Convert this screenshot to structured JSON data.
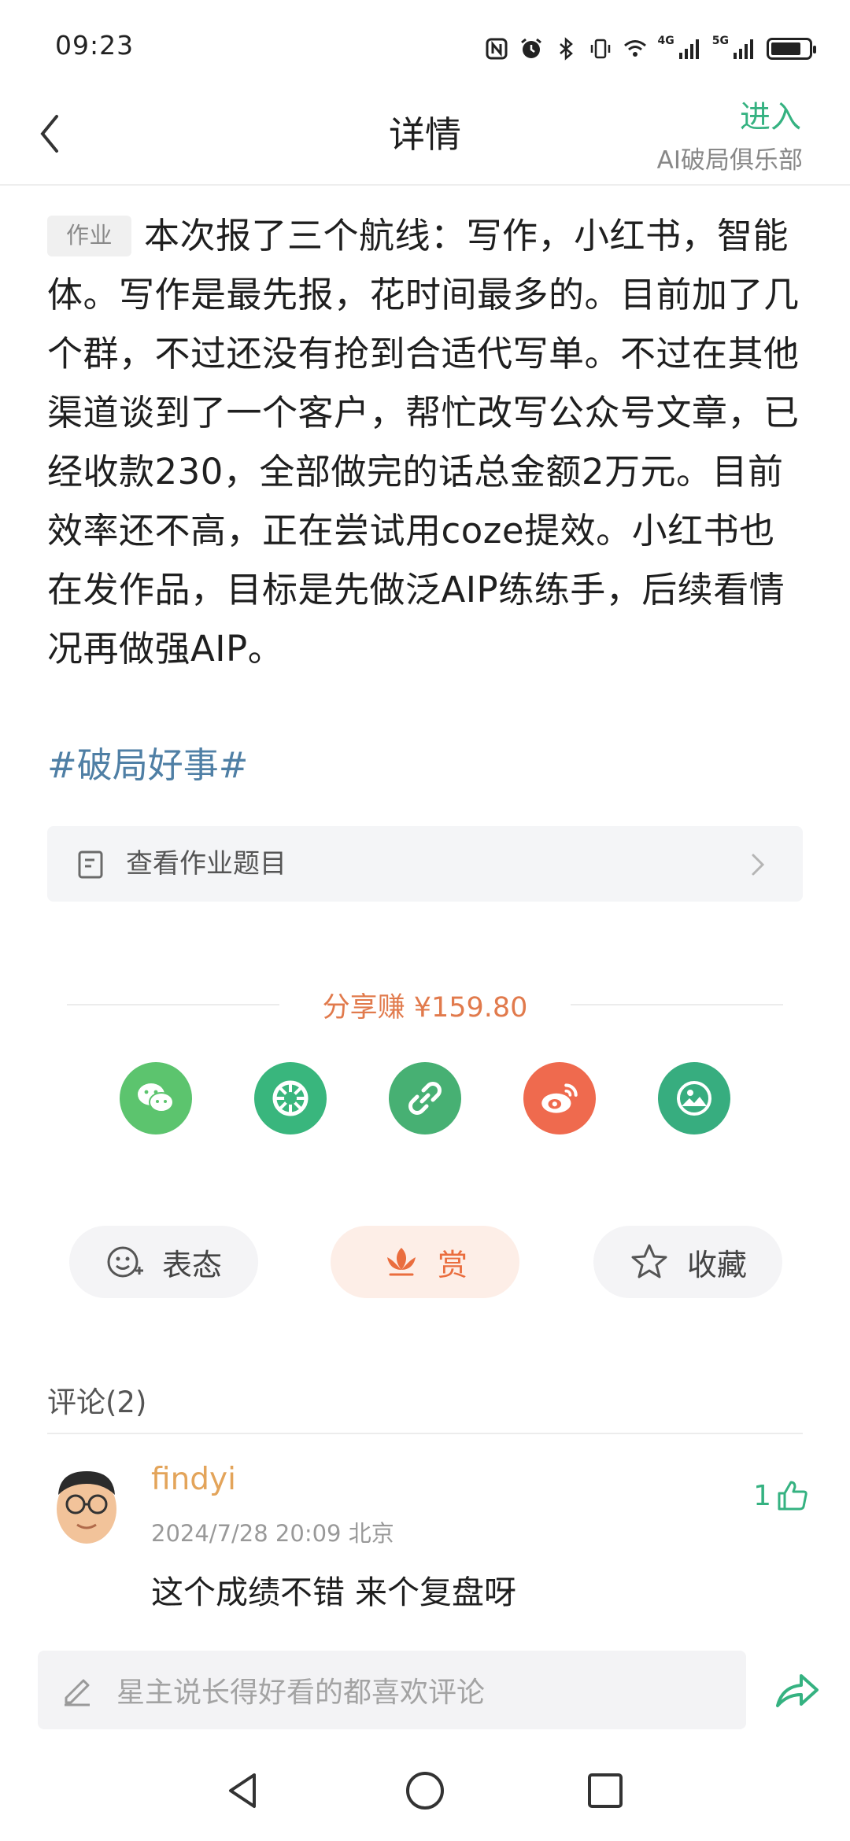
{
  "status_bar": {
    "time": "09:23",
    "signal_labels": [
      "4G",
      "5G"
    ]
  },
  "nav": {
    "title": "详情",
    "enter_label": "进入",
    "club_name": "AI破局俱乐部"
  },
  "post": {
    "tag": "作业",
    "body": "本次报了三个航线：写作，小红书，智能体。写作是最先报，花时间最多的。目前加了几个群，不过还没有抢到合适代写单。不过在其他渠道谈到了一个客户，帮忙改写公众号文章，已经收款230，全部做完的话总金额2万元。目前效率还不高，正在尝试用coze提效。小红书也在发作品，目标是先做泛AIP练练手，后续看情况再做强AIP。",
    "hashtag": "#破局好事#"
  },
  "homework": {
    "label": "查看作业题目"
  },
  "share": {
    "earn_label": "分享赚 ¥159.80",
    "buttons": [
      {
        "icon": "wechat-icon",
        "color": "#5cc46e"
      },
      {
        "icon": "moments-icon",
        "color": "#39b67d"
      },
      {
        "icon": "link-icon",
        "color": "#47b073"
      },
      {
        "icon": "weibo-icon",
        "color": "#ef6a4e"
      },
      {
        "icon": "image-icon",
        "color": "#37ad7f"
      }
    ]
  },
  "actions": {
    "react_label": "表态",
    "reward_label": "赏",
    "favorite_label": "收藏"
  },
  "comments": {
    "title": "评论(2)",
    "items": [
      {
        "user": "findyi",
        "meta": "2024/7/28 20:09  北京",
        "text": "这个成绩不错 来个复盘呀",
        "likes": "1"
      }
    ]
  },
  "input": {
    "placeholder": "星主说长得好看的都喜欢评论"
  },
  "colors": {
    "accent": "#35b281",
    "orange": "#e17a4c",
    "link": "#4f7fa5"
  }
}
